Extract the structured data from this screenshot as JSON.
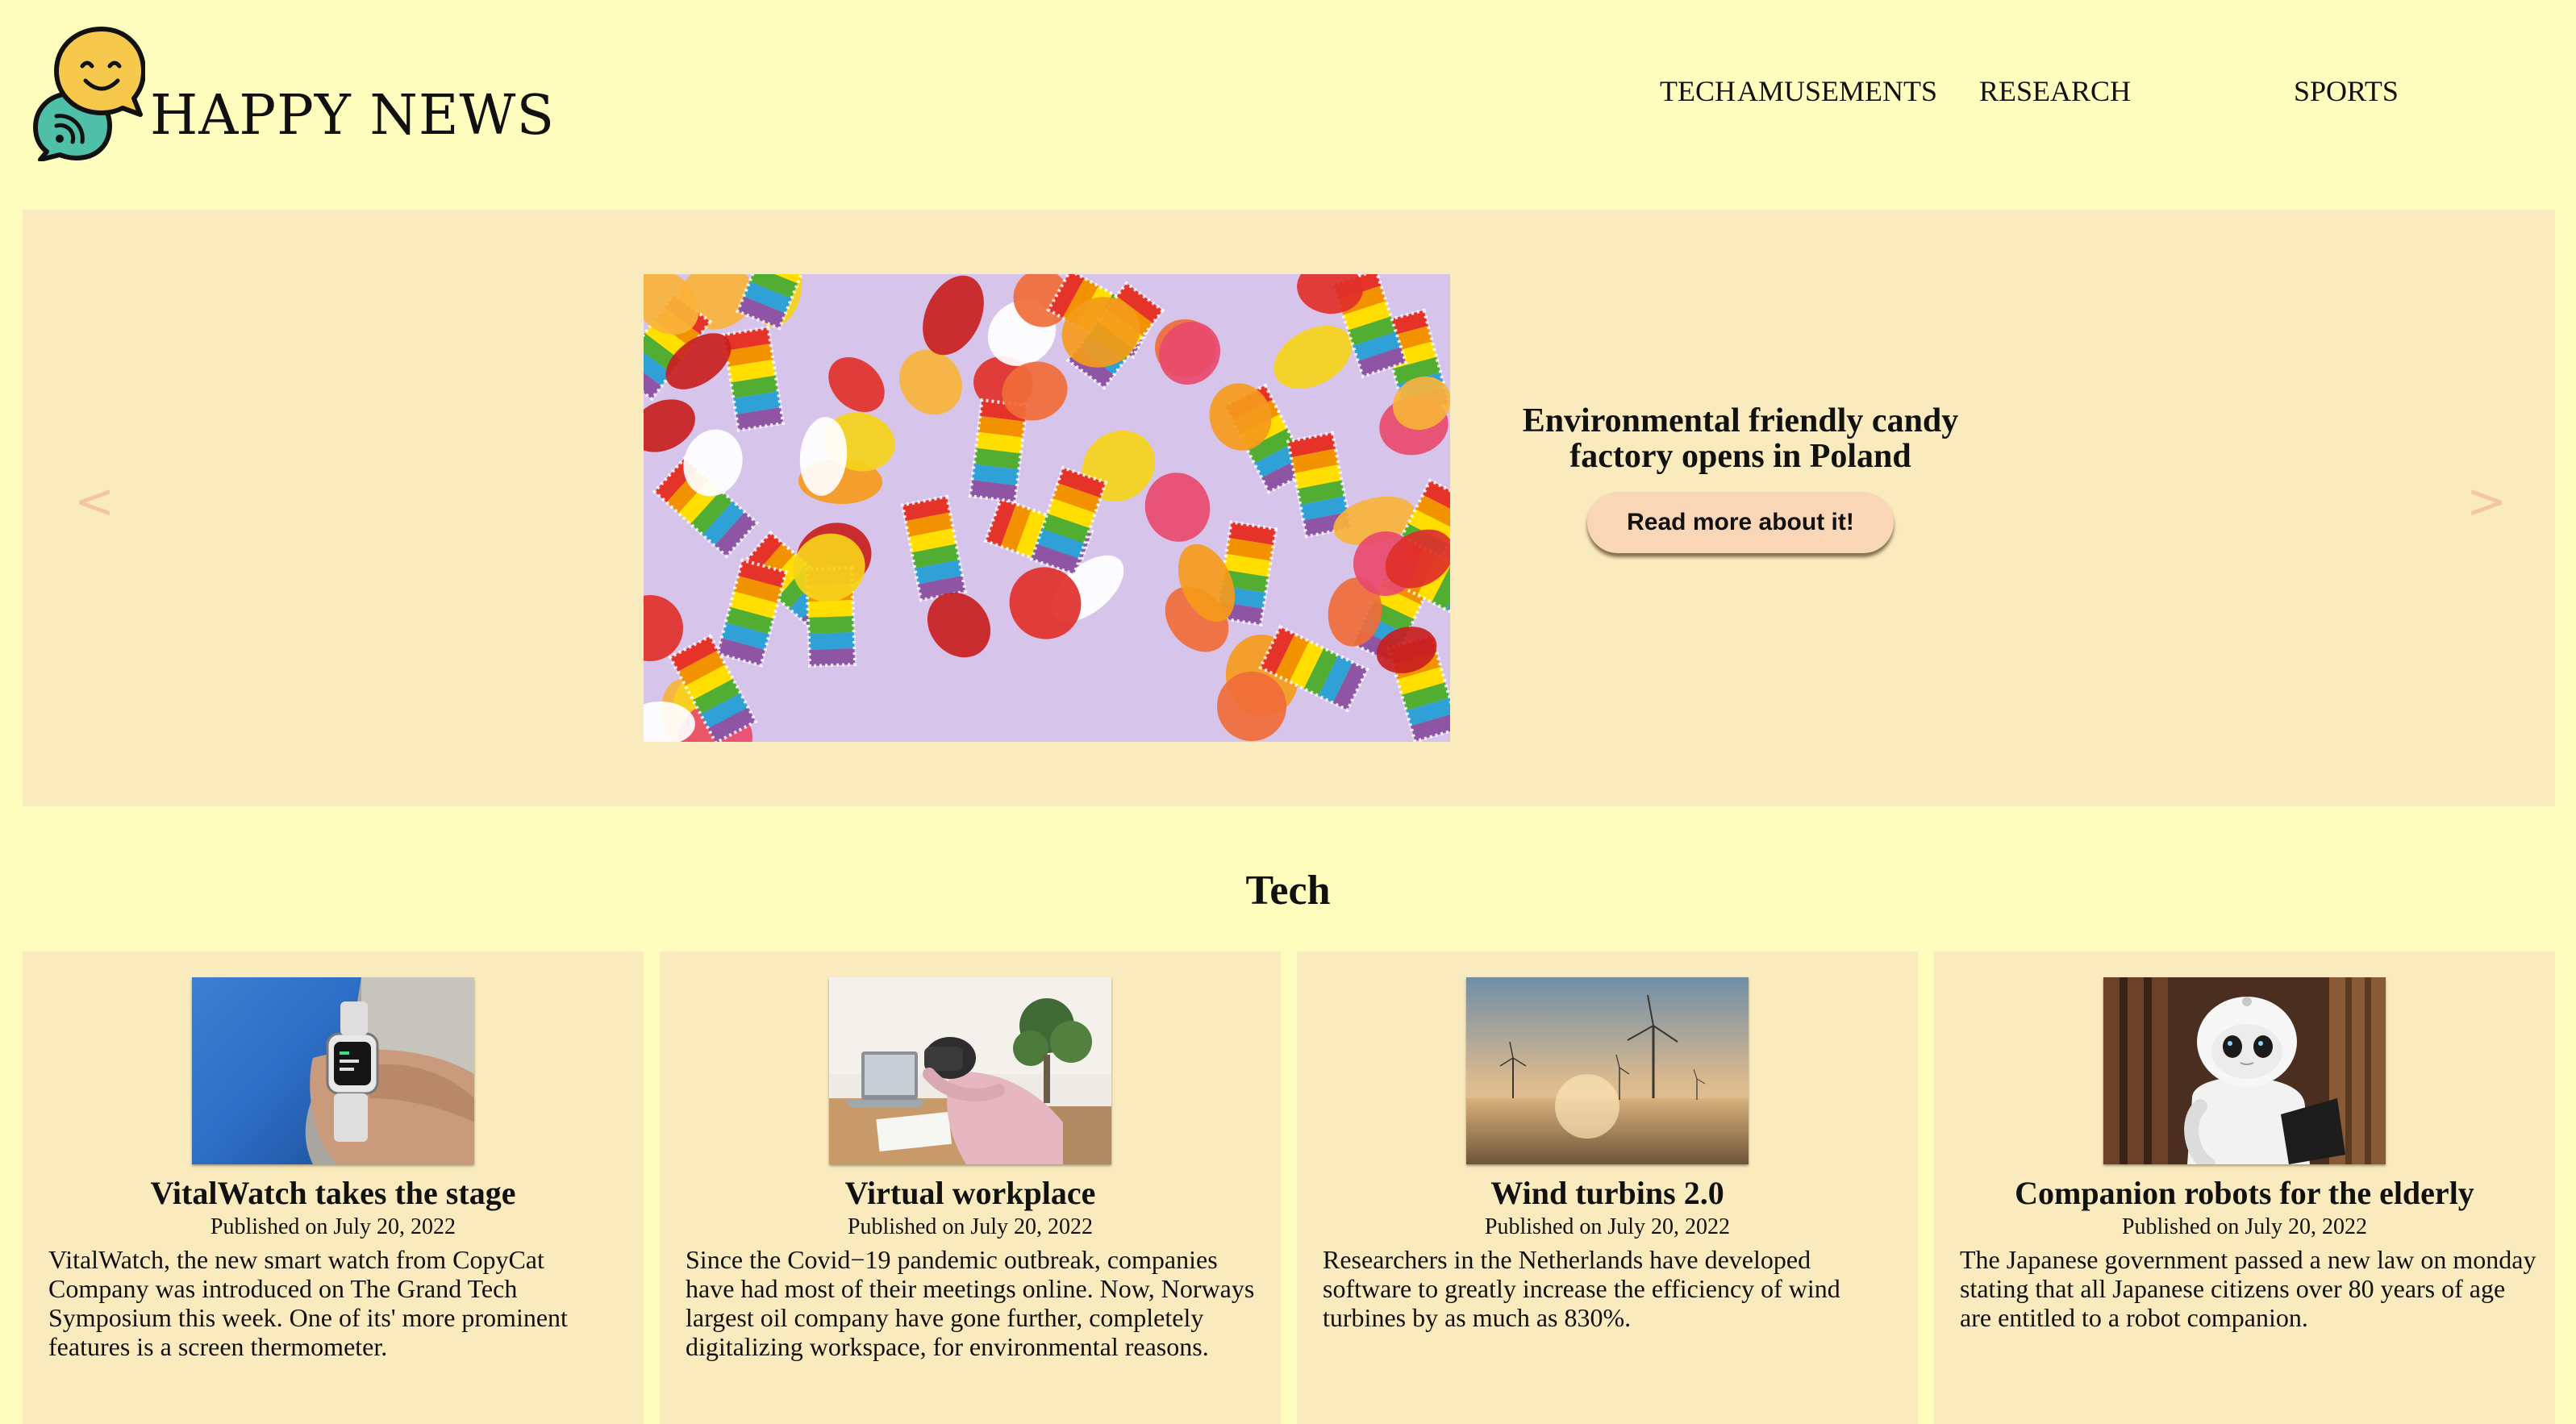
{
  "header": {
    "brand": "HAPPY NEWS",
    "logo_icon": "chat-smiley-bubbles-icon"
  },
  "nav": {
    "items": [
      {
        "label": "TECH"
      },
      {
        "label": "AMUSEMENTS"
      },
      {
        "label": "RESEARCH"
      },
      {
        "label": "SPORTS"
      }
    ]
  },
  "hero": {
    "prev_label": "<",
    "next_label": ">",
    "image_subject": "gummy candy",
    "title": "Environmental friendly candy factory opens in Poland",
    "button_label": "Read more about it!"
  },
  "section": {
    "title": "Tech"
  },
  "cards": [
    {
      "image_subject": "smart watch",
      "title": "VitalWatch takes the stage",
      "date": "Published on July 20, 2022",
      "body": "VitalWatch, the new smart watch from CopyCat Company was introduced on The Grand Tech Symposium this week. One of its' more prominent features is a screen thermometer."
    },
    {
      "image_subject": "vr headset at desk",
      "title": "Virtual workplace",
      "date": "Published on July 20, 2022",
      "body": "Since the Covid−19 pandemic outbreak, companies have had most of their meetings online. Now, Norways largest oil company have gone further, completely digitalizing workspace, for environmental reasons."
    },
    {
      "image_subject": "wind turbines",
      "title": "Wind turbins 2.0",
      "date": "Published on July 20, 2022",
      "body": "Researchers in the Netherlands have developed software to greatly increase the efficiency of wind turbines by as much as 830%."
    },
    {
      "image_subject": "robot",
      "title": "Companion robots for the elderly",
      "date": "Published on July 20, 2022",
      "body": "The Japanese government passed a new law on monday stating that all Japanese citizens over 80 years of age are entitled to a robot companion."
    }
  ],
  "colors": {
    "page_bg": "#fefdbd",
    "panel_bg": "#faebbe",
    "button_bg": "#f8d6b6",
    "arrow": "#f4c5a0",
    "logo_yellow": "#f6c94c",
    "logo_teal": "#4fbfa8"
  }
}
